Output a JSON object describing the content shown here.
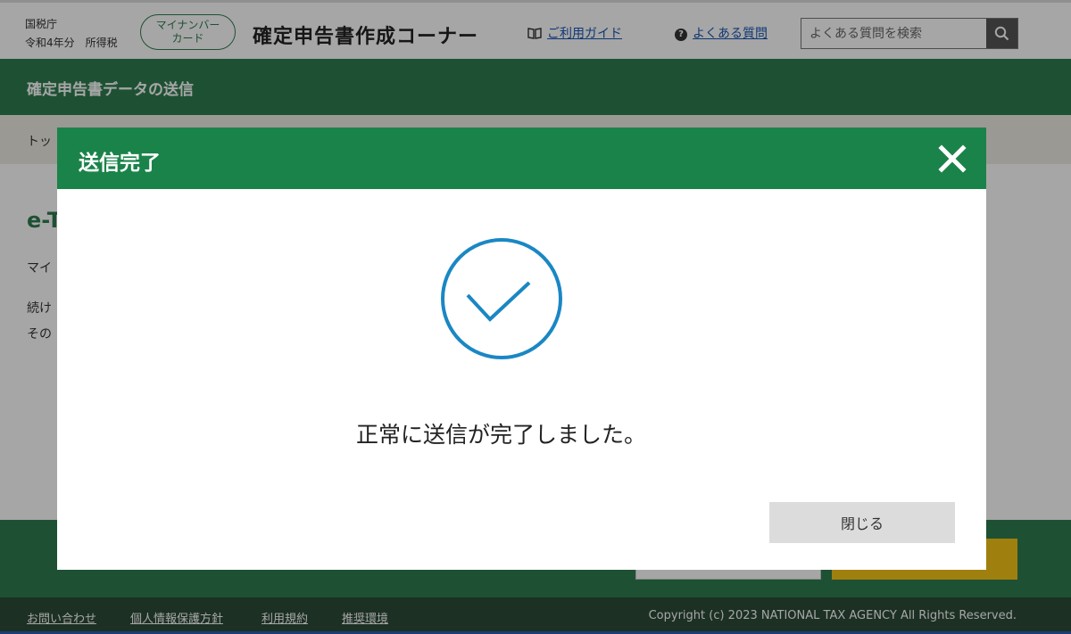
{
  "header": {
    "org_line1": "国税庁",
    "org_line2": "令和4年分　所得税",
    "mynumber_badge_line1": "マイナンバー",
    "mynumber_badge_line2": "カード",
    "site_title": "確定申告書作成コーナー",
    "guide_link": "ご利用ガイド",
    "faq_link": "よくある質問",
    "search_placeholder": "よくある質問を検索",
    "guide_icon": "book-icon",
    "faq_icon": "question-circle-icon",
    "search_icon": "magnifier-icon"
  },
  "page": {
    "heading": "確定申告書データの送信",
    "breadcrumb_visible": "トッ",
    "section_title_visible": "e-T",
    "body_line1_visible": "マイ",
    "body_line2_visible": "続け",
    "body_line3_visible": "その"
  },
  "modal": {
    "title": "送信完了",
    "message": "正常に送信が完了しました。",
    "close_button_label": "閉じる",
    "close_icon": "close-icon",
    "check_icon": "check-circle-icon"
  },
  "footer": {
    "links": [
      "お問い合わせ",
      "個人情報保護方針",
      "利用規約",
      "推奨環境"
    ],
    "copyright": "Copyright (c) 2023 NATIONAL TAX AGENCY All Rights Reserved."
  },
  "colors": {
    "brand_green": "#2e7d4f",
    "modal_header_green": "#1a834a",
    "check_blue": "#1a87c4",
    "next_button_yellow": "#f5c518"
  }
}
